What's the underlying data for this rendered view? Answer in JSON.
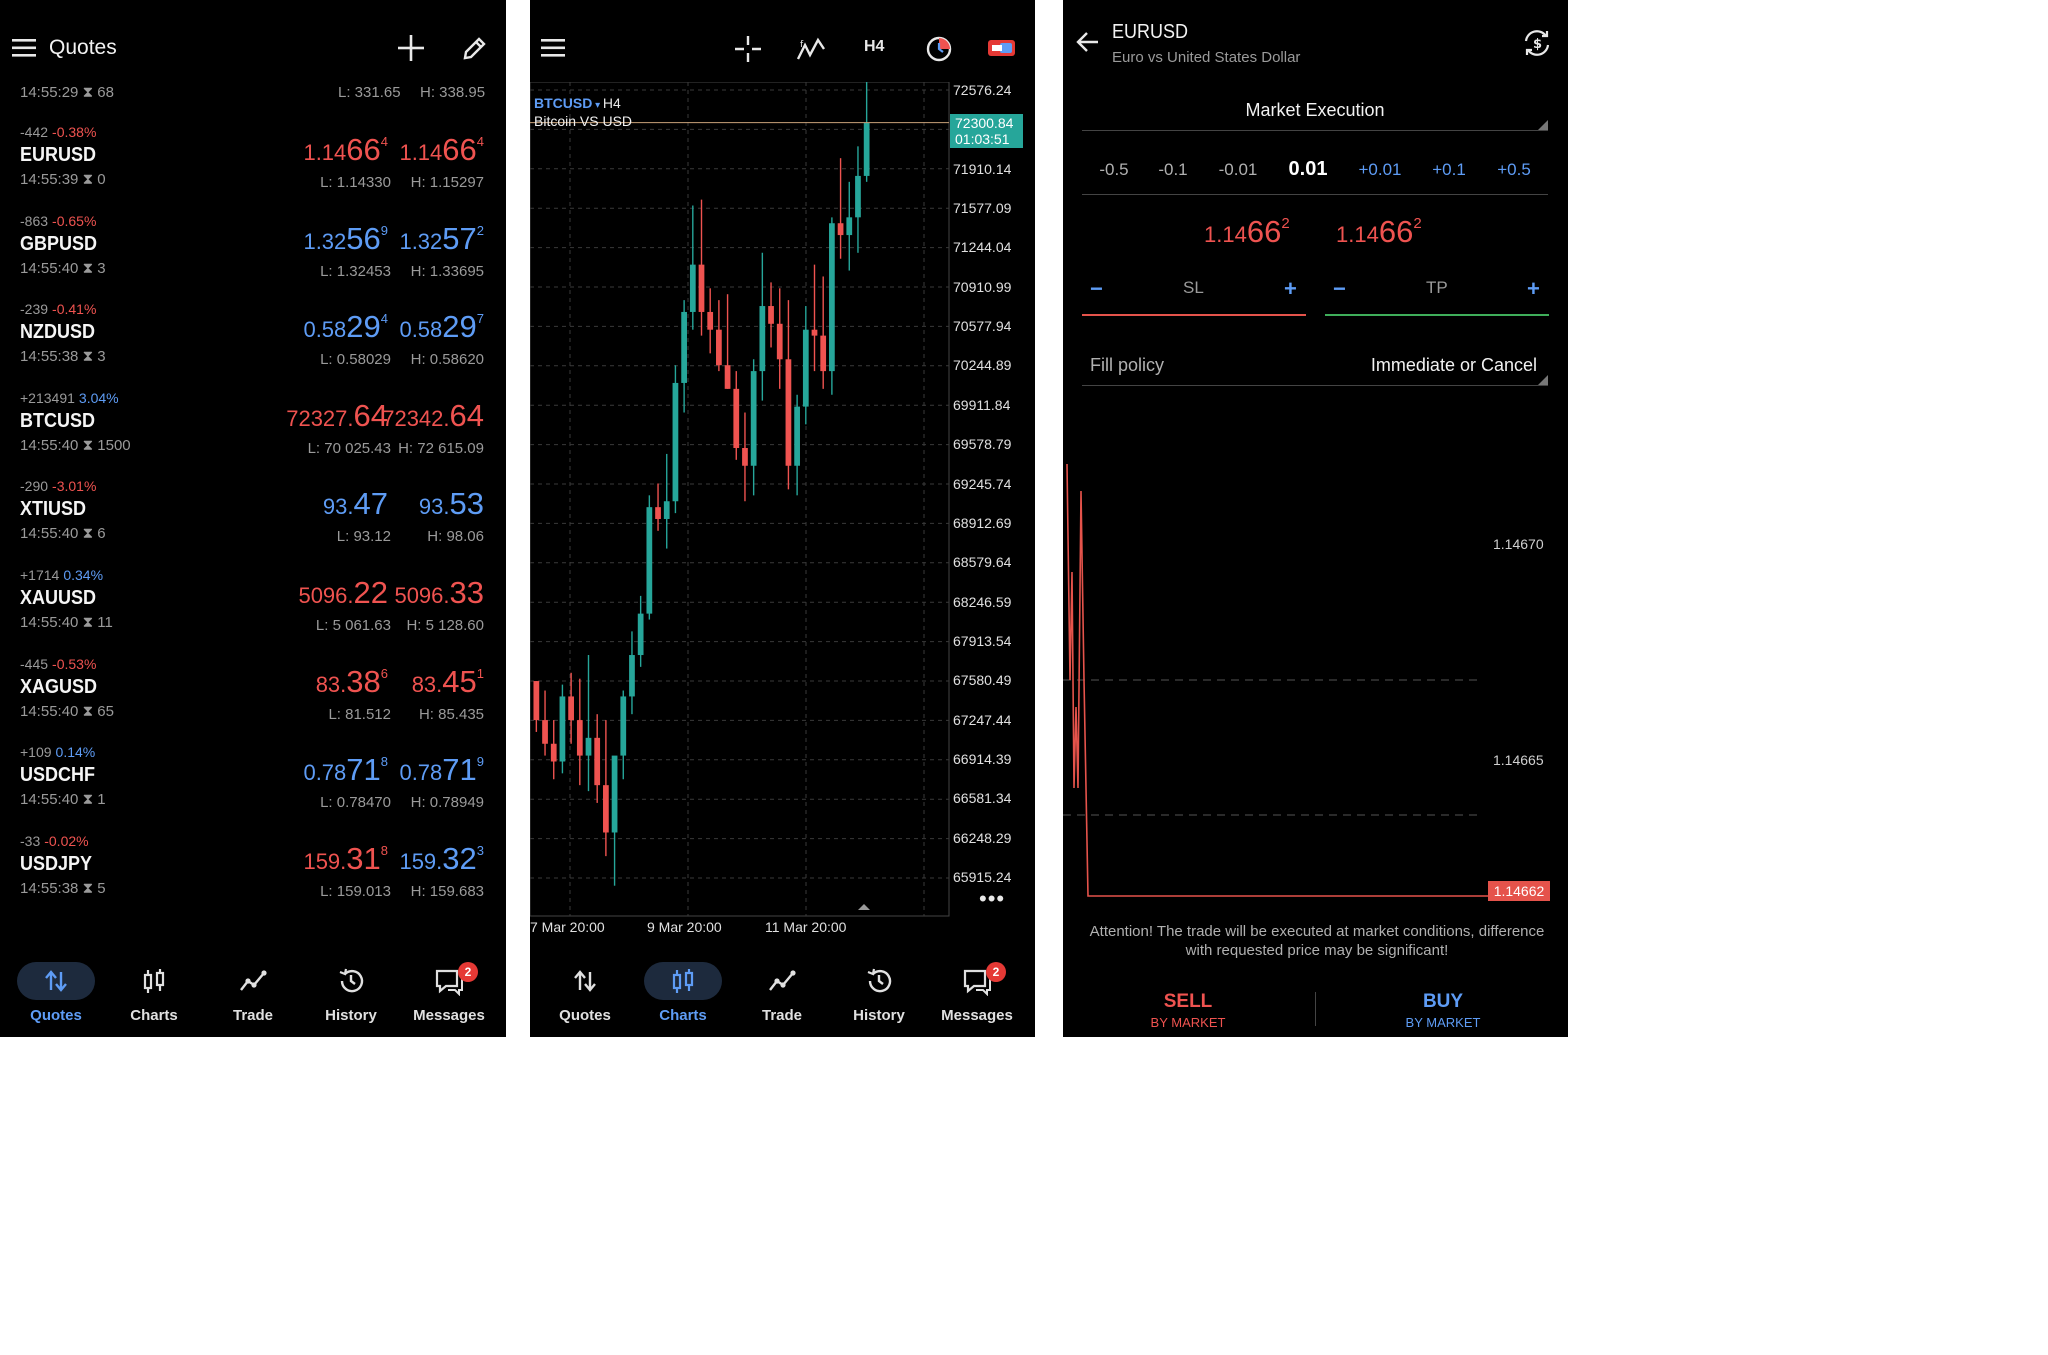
{
  "quotes": {
    "title": "Quotes",
    "header_row": {
      "time": "14:55:29",
      "spread": "68",
      "low": "L: 331.65",
      "high": "H: 338.95"
    },
    "rows": [
      {
        "change": "-442",
        "pct": "-0.38%",
        "pct_color": "red",
        "symbol": "EURUSD",
        "time": "14:55:39",
        "spread": "0",
        "bid_pre": "1.14",
        "bid_big": "66",
        "bid_sup": "4",
        "bid_color": "red",
        "ask_pre": "1.14",
        "ask_big": "66",
        "ask_sup": "4",
        "ask_color": "red",
        "low": "L: 1.14330",
        "high": "H: 1.15297"
      },
      {
        "change": "-863",
        "pct": "-0.65%",
        "pct_color": "red",
        "symbol": "GBPUSD",
        "time": "14:55:40",
        "spread": "3",
        "bid_pre": "1.32",
        "bid_big": "56",
        "bid_sup": "9",
        "bid_color": "blue",
        "ask_pre": "1.32",
        "ask_big": "57",
        "ask_sup": "2",
        "ask_color": "blue",
        "low": "L: 1.32453",
        "high": "H: 1.33695"
      },
      {
        "change": "-239",
        "pct": "-0.41%",
        "pct_color": "red",
        "symbol": "NZDUSD",
        "time": "14:55:38",
        "spread": "3",
        "bid_pre": "0.58",
        "bid_big": "29",
        "bid_sup": "4",
        "bid_color": "blue",
        "ask_pre": "0.58",
        "ask_big": "29",
        "ask_sup": "7",
        "ask_color": "blue",
        "low": "L: 0.58029",
        "high": "H: 0.58620"
      },
      {
        "change": "+213491",
        "pct": "3.04%",
        "pct_color": "blue",
        "symbol": "BTCUSD",
        "time": "14:55:40",
        "spread": "1500",
        "bid_pre": "72327.",
        "bid_big": "64",
        "bid_sup": "",
        "bid_color": "red",
        "ask_pre": "72342.",
        "ask_big": "64",
        "ask_sup": "",
        "ask_color": "red",
        "low": "L: 70 025.43",
        "high": "H: 72 615.09"
      },
      {
        "change": "-290",
        "pct": "-3.01%",
        "pct_color": "red",
        "symbol": "XTIUSD",
        "time": "14:55:40",
        "spread": "6",
        "bid_pre": "93.",
        "bid_big": "47",
        "bid_sup": "",
        "bid_color": "blue",
        "ask_pre": "93.",
        "ask_big": "53",
        "ask_sup": "",
        "ask_color": "blue",
        "low": "L: 93.12",
        "high": "H: 98.06"
      },
      {
        "change": "+1714",
        "pct": "0.34%",
        "pct_color": "blue",
        "symbol": "XAUUSD",
        "time": "14:55:40",
        "spread": "11",
        "bid_pre": "5096.",
        "bid_big": "22",
        "bid_sup": "",
        "bid_color": "red",
        "ask_pre": "5096.",
        "ask_big": "33",
        "ask_sup": "",
        "ask_color": "red",
        "low": "L: 5 061.63",
        "high": "H: 5 128.60"
      },
      {
        "change": "-445",
        "pct": "-0.53%",
        "pct_color": "red",
        "symbol": "XAGUSD",
        "time": "14:55:40",
        "spread": "65",
        "bid_pre": "83.",
        "bid_big": "38",
        "bid_sup": "6",
        "bid_color": "red",
        "ask_pre": "83.",
        "ask_big": "45",
        "ask_sup": "1",
        "ask_color": "red",
        "low": "L: 81.512",
        "high": "H: 85.435"
      },
      {
        "change": "+109",
        "pct": "0.14%",
        "pct_color": "blue",
        "symbol": "USDCHF",
        "time": "14:55:40",
        "spread": "1",
        "bid_pre": "0.78",
        "bid_big": "71",
        "bid_sup": "8",
        "bid_color": "blue",
        "ask_pre": "0.78",
        "ask_big": "71",
        "ask_sup": "9",
        "ask_color": "blue",
        "low": "L: 0.78470",
        "high": "H: 0.78949"
      },
      {
        "change": "-33",
        "pct": "-0.02%",
        "pct_color": "red",
        "symbol": "USDJPY",
        "time": "14:55:38",
        "spread": "5",
        "bid_pre": "159.",
        "bid_big": "31",
        "bid_sup": "8",
        "bid_color": "red",
        "ask_pre": "159.",
        "ask_big": "32",
        "ask_sup": "3",
        "ask_color": "blue",
        "low": "L: 159.013",
        "high": "H: 159.683"
      }
    ]
  },
  "nav": {
    "items": [
      {
        "label": "Quotes",
        "icon": "arrows-updown-icon"
      },
      {
        "label": "Charts",
        "icon": "candles-icon"
      },
      {
        "label": "Trade",
        "icon": "trade-line-icon"
      },
      {
        "label": "History",
        "icon": "history-icon"
      },
      {
        "label": "Messages",
        "icon": "messages-icon",
        "badge": "2"
      }
    ]
  },
  "chart": {
    "toolbar_timeframe": "H4",
    "symbol": "BTCUSD",
    "symbol_suffix": "H4",
    "description": "Bitcoin VS USD",
    "current_price": "72300.84",
    "countdown": "01:03:51",
    "y_ticks": [
      "72576.24",
      "72243.19",
      "71910.14",
      "71577.09",
      "71244.04",
      "70910.99",
      "70577.94",
      "70244.89",
      "69911.84",
      "69578.79",
      "69245.74",
      "68912.69",
      "68579.64",
      "68246.59",
      "67913.54",
      "67580.49",
      "67247.44",
      "66914.39",
      "66581.34",
      "66248.29",
      "65915.24"
    ],
    "x_ticks": [
      "7 Mar 20:00",
      "9 Mar 20:00",
      "11 Mar 20:00"
    ],
    "colors": {
      "bull": "#26a69a",
      "bear": "#ef5350"
    }
  },
  "chart_data": {
    "type": "candlestick",
    "symbol": "BTCUSD",
    "timeframe": "H4",
    "ylim": [
      65915.24,
      72576.24
    ],
    "candles": [
      [
        67580,
        67580,
        67150,
        67250
      ],
      [
        67250,
        67500,
        66950,
        67050
      ],
      [
        67050,
        67250,
        66750,
        66900
      ],
      [
        66900,
        67550,
        66800,
        67450
      ],
      [
        67450,
        67650,
        67050,
        67250
      ],
      [
        67250,
        67600,
        66700,
        66950
      ],
      [
        66950,
        67800,
        66650,
        67100
      ],
      [
        67100,
        67300,
        66550,
        66700
      ],
      [
        66700,
        67250,
        66100,
        66300
      ],
      [
        66300,
        66800,
        65850,
        66950
      ],
      [
        66950,
        67500,
        66750,
        67450
      ],
      [
        67450,
        68000,
        67300,
        67800
      ],
      [
        67800,
        68300,
        67700,
        68150
      ],
      [
        68150,
        69150,
        68100,
        69050
      ],
      [
        69050,
        69250,
        68850,
        68950
      ],
      [
        68950,
        69500,
        68700,
        69100
      ],
      [
        69100,
        70250,
        69000,
        70100
      ],
      [
        70100,
        70800,
        69850,
        70700
      ],
      [
        70700,
        71600,
        70550,
        71100
      ],
      [
        71100,
        71650,
        70500,
        70700
      ],
      [
        70700,
        70900,
        70350,
        70550
      ],
      [
        70550,
        70800,
        70200,
        70250
      ],
      [
        70250,
        70850,
        70050,
        70050
      ],
      [
        70050,
        70200,
        69450,
        69550
      ],
      [
        69550,
        69850,
        69100,
        69400
      ],
      [
        69400,
        70300,
        69150,
        70200
      ],
      [
        70200,
        71200,
        69950,
        70750
      ],
      [
        70750,
        70950,
        70400,
        70600
      ],
      [
        70600,
        70900,
        70050,
        70300
      ],
      [
        70300,
        70800,
        69200,
        69400
      ],
      [
        69400,
        70000,
        69150,
        69900
      ],
      [
        69900,
        70750,
        69750,
        70550
      ],
      [
        70550,
        71100,
        70200,
        70500
      ],
      [
        70500,
        71000,
        70050,
        70200
      ],
      [
        70200,
        71500,
        70000,
        71450
      ],
      [
        71450,
        72000,
        71150,
        71350
      ],
      [
        71350,
        71800,
        71050,
        71500
      ],
      [
        71500,
        72100,
        71200,
        71850
      ],
      [
        71850,
        72650,
        71800,
        72300
      ]
    ]
  },
  "order": {
    "symbol": "EURUSD",
    "description": "Euro vs United States Dollar",
    "mode": "Market Execution",
    "volume_steps": [
      "-0.5",
      "-0.1",
      "-0.01",
      "0.01",
      "+0.01",
      "+0.1",
      "+0.5"
    ],
    "sell_price": {
      "pre": "1.14",
      "big": "66",
      "sup": "2"
    },
    "buy_price": {
      "pre": "1.14",
      "big": "66",
      "sup": "2"
    },
    "sl_label": "SL",
    "tp_label": "TP",
    "minus": "−",
    "plus": "+",
    "fill_policy_label": "Fill policy",
    "fill_policy_value": "Immediate or Cancel",
    "price_ticks": [
      "1.14670",
      "1.14665"
    ],
    "last_price": "1.14662",
    "attention": "Attention! The trade will be executed at market conditions, difference with requested price may be significant!",
    "sell_label": "SELL",
    "sell_sub": "BY MARKET",
    "buy_label": "BUY",
    "buy_sub": "BY MARKET",
    "tick_series": [
      1.14678,
      1.1467,
      1.14674,
      1.14666,
      1.14669,
      1.14666,
      1.14677,
      1.1467,
      1.14662,
      1.14662,
      1.14662
    ],
    "colors": {
      "sell": "#ef5350",
      "buy": "#5e9cf5",
      "sl": "#e5534b",
      "tp": "#3fae5a"
    }
  }
}
